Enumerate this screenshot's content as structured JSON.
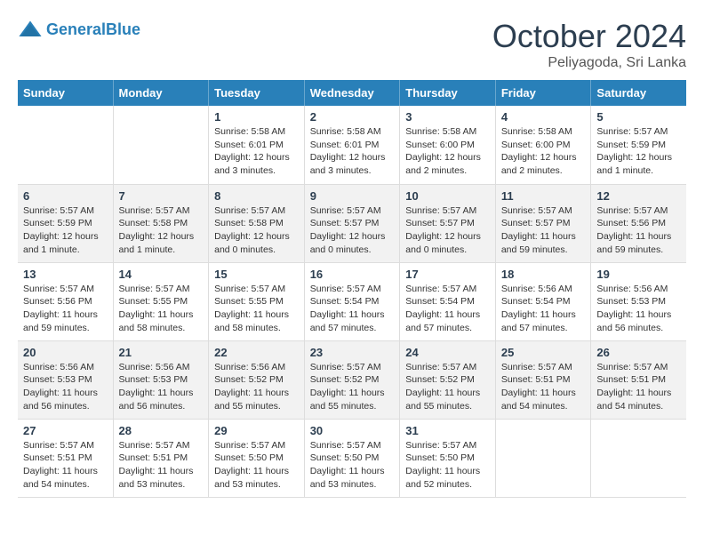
{
  "header": {
    "logo_line1": "General",
    "logo_line2": "Blue",
    "month": "October 2024",
    "location": "Peliyagoda, Sri Lanka"
  },
  "calendar": {
    "days_of_week": [
      "Sunday",
      "Monday",
      "Tuesday",
      "Wednesday",
      "Thursday",
      "Friday",
      "Saturday"
    ],
    "weeks": [
      [
        {
          "day": "",
          "info": ""
        },
        {
          "day": "",
          "info": ""
        },
        {
          "day": "1",
          "info": "Sunrise: 5:58 AM\nSunset: 6:01 PM\nDaylight: 12 hours\nand 3 minutes."
        },
        {
          "day": "2",
          "info": "Sunrise: 5:58 AM\nSunset: 6:01 PM\nDaylight: 12 hours\nand 3 minutes."
        },
        {
          "day": "3",
          "info": "Sunrise: 5:58 AM\nSunset: 6:00 PM\nDaylight: 12 hours\nand 2 minutes."
        },
        {
          "day": "4",
          "info": "Sunrise: 5:58 AM\nSunset: 6:00 PM\nDaylight: 12 hours\nand 2 minutes."
        },
        {
          "day": "5",
          "info": "Sunrise: 5:57 AM\nSunset: 5:59 PM\nDaylight: 12 hours\nand 1 minute."
        }
      ],
      [
        {
          "day": "6",
          "info": "Sunrise: 5:57 AM\nSunset: 5:59 PM\nDaylight: 12 hours\nand 1 minute."
        },
        {
          "day": "7",
          "info": "Sunrise: 5:57 AM\nSunset: 5:58 PM\nDaylight: 12 hours\nand 1 minute."
        },
        {
          "day": "8",
          "info": "Sunrise: 5:57 AM\nSunset: 5:58 PM\nDaylight: 12 hours\nand 0 minutes."
        },
        {
          "day": "9",
          "info": "Sunrise: 5:57 AM\nSunset: 5:57 PM\nDaylight: 12 hours\nand 0 minutes."
        },
        {
          "day": "10",
          "info": "Sunrise: 5:57 AM\nSunset: 5:57 PM\nDaylight: 12 hours\nand 0 minutes."
        },
        {
          "day": "11",
          "info": "Sunrise: 5:57 AM\nSunset: 5:57 PM\nDaylight: 11 hours\nand 59 minutes."
        },
        {
          "day": "12",
          "info": "Sunrise: 5:57 AM\nSunset: 5:56 PM\nDaylight: 11 hours\nand 59 minutes."
        }
      ],
      [
        {
          "day": "13",
          "info": "Sunrise: 5:57 AM\nSunset: 5:56 PM\nDaylight: 11 hours\nand 59 minutes."
        },
        {
          "day": "14",
          "info": "Sunrise: 5:57 AM\nSunset: 5:55 PM\nDaylight: 11 hours\nand 58 minutes."
        },
        {
          "day": "15",
          "info": "Sunrise: 5:57 AM\nSunset: 5:55 PM\nDaylight: 11 hours\nand 58 minutes."
        },
        {
          "day": "16",
          "info": "Sunrise: 5:57 AM\nSunset: 5:54 PM\nDaylight: 11 hours\nand 57 minutes."
        },
        {
          "day": "17",
          "info": "Sunrise: 5:57 AM\nSunset: 5:54 PM\nDaylight: 11 hours\nand 57 minutes."
        },
        {
          "day": "18",
          "info": "Sunrise: 5:56 AM\nSunset: 5:54 PM\nDaylight: 11 hours\nand 57 minutes."
        },
        {
          "day": "19",
          "info": "Sunrise: 5:56 AM\nSunset: 5:53 PM\nDaylight: 11 hours\nand 56 minutes."
        }
      ],
      [
        {
          "day": "20",
          "info": "Sunrise: 5:56 AM\nSunset: 5:53 PM\nDaylight: 11 hours\nand 56 minutes."
        },
        {
          "day": "21",
          "info": "Sunrise: 5:56 AM\nSunset: 5:53 PM\nDaylight: 11 hours\nand 56 minutes."
        },
        {
          "day": "22",
          "info": "Sunrise: 5:56 AM\nSunset: 5:52 PM\nDaylight: 11 hours\nand 55 minutes."
        },
        {
          "day": "23",
          "info": "Sunrise: 5:57 AM\nSunset: 5:52 PM\nDaylight: 11 hours\nand 55 minutes."
        },
        {
          "day": "24",
          "info": "Sunrise: 5:57 AM\nSunset: 5:52 PM\nDaylight: 11 hours\nand 55 minutes."
        },
        {
          "day": "25",
          "info": "Sunrise: 5:57 AM\nSunset: 5:51 PM\nDaylight: 11 hours\nand 54 minutes."
        },
        {
          "day": "26",
          "info": "Sunrise: 5:57 AM\nSunset: 5:51 PM\nDaylight: 11 hours\nand 54 minutes."
        }
      ],
      [
        {
          "day": "27",
          "info": "Sunrise: 5:57 AM\nSunset: 5:51 PM\nDaylight: 11 hours\nand 54 minutes."
        },
        {
          "day": "28",
          "info": "Sunrise: 5:57 AM\nSunset: 5:51 PM\nDaylight: 11 hours\nand 53 minutes."
        },
        {
          "day": "29",
          "info": "Sunrise: 5:57 AM\nSunset: 5:50 PM\nDaylight: 11 hours\nand 53 minutes."
        },
        {
          "day": "30",
          "info": "Sunrise: 5:57 AM\nSunset: 5:50 PM\nDaylight: 11 hours\nand 53 minutes."
        },
        {
          "day": "31",
          "info": "Sunrise: 5:57 AM\nSunset: 5:50 PM\nDaylight: 11 hours\nand 52 minutes."
        },
        {
          "day": "",
          "info": ""
        },
        {
          "day": "",
          "info": ""
        }
      ]
    ]
  }
}
